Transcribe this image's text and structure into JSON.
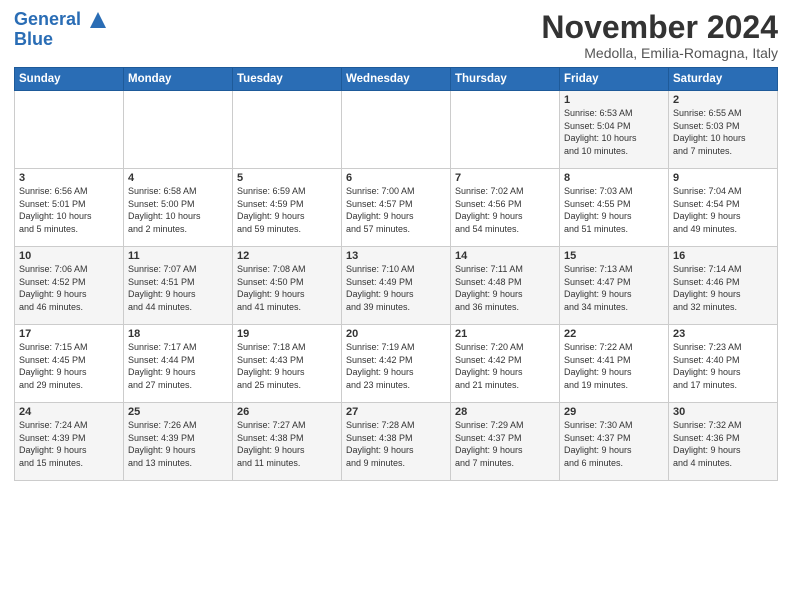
{
  "header": {
    "logo_line1": "General",
    "logo_line2": "Blue",
    "month_title": "November 2024",
    "subtitle": "Medolla, Emilia-Romagna, Italy"
  },
  "weekdays": [
    "Sunday",
    "Monday",
    "Tuesday",
    "Wednesday",
    "Thursday",
    "Friday",
    "Saturday"
  ],
  "weeks": [
    [
      {
        "day": "",
        "info": ""
      },
      {
        "day": "",
        "info": ""
      },
      {
        "day": "",
        "info": ""
      },
      {
        "day": "",
        "info": ""
      },
      {
        "day": "",
        "info": ""
      },
      {
        "day": "1",
        "info": "Sunrise: 6:53 AM\nSunset: 5:04 PM\nDaylight: 10 hours\nand 10 minutes."
      },
      {
        "day": "2",
        "info": "Sunrise: 6:55 AM\nSunset: 5:03 PM\nDaylight: 10 hours\nand 7 minutes."
      }
    ],
    [
      {
        "day": "3",
        "info": "Sunrise: 6:56 AM\nSunset: 5:01 PM\nDaylight: 10 hours\nand 5 minutes."
      },
      {
        "day": "4",
        "info": "Sunrise: 6:58 AM\nSunset: 5:00 PM\nDaylight: 10 hours\nand 2 minutes."
      },
      {
        "day": "5",
        "info": "Sunrise: 6:59 AM\nSunset: 4:59 PM\nDaylight: 9 hours\nand 59 minutes."
      },
      {
        "day": "6",
        "info": "Sunrise: 7:00 AM\nSunset: 4:57 PM\nDaylight: 9 hours\nand 57 minutes."
      },
      {
        "day": "7",
        "info": "Sunrise: 7:02 AM\nSunset: 4:56 PM\nDaylight: 9 hours\nand 54 minutes."
      },
      {
        "day": "8",
        "info": "Sunrise: 7:03 AM\nSunset: 4:55 PM\nDaylight: 9 hours\nand 51 minutes."
      },
      {
        "day": "9",
        "info": "Sunrise: 7:04 AM\nSunset: 4:54 PM\nDaylight: 9 hours\nand 49 minutes."
      }
    ],
    [
      {
        "day": "10",
        "info": "Sunrise: 7:06 AM\nSunset: 4:52 PM\nDaylight: 9 hours\nand 46 minutes."
      },
      {
        "day": "11",
        "info": "Sunrise: 7:07 AM\nSunset: 4:51 PM\nDaylight: 9 hours\nand 44 minutes."
      },
      {
        "day": "12",
        "info": "Sunrise: 7:08 AM\nSunset: 4:50 PM\nDaylight: 9 hours\nand 41 minutes."
      },
      {
        "day": "13",
        "info": "Sunrise: 7:10 AM\nSunset: 4:49 PM\nDaylight: 9 hours\nand 39 minutes."
      },
      {
        "day": "14",
        "info": "Sunrise: 7:11 AM\nSunset: 4:48 PM\nDaylight: 9 hours\nand 36 minutes."
      },
      {
        "day": "15",
        "info": "Sunrise: 7:13 AM\nSunset: 4:47 PM\nDaylight: 9 hours\nand 34 minutes."
      },
      {
        "day": "16",
        "info": "Sunrise: 7:14 AM\nSunset: 4:46 PM\nDaylight: 9 hours\nand 32 minutes."
      }
    ],
    [
      {
        "day": "17",
        "info": "Sunrise: 7:15 AM\nSunset: 4:45 PM\nDaylight: 9 hours\nand 29 minutes."
      },
      {
        "day": "18",
        "info": "Sunrise: 7:17 AM\nSunset: 4:44 PM\nDaylight: 9 hours\nand 27 minutes."
      },
      {
        "day": "19",
        "info": "Sunrise: 7:18 AM\nSunset: 4:43 PM\nDaylight: 9 hours\nand 25 minutes."
      },
      {
        "day": "20",
        "info": "Sunrise: 7:19 AM\nSunset: 4:42 PM\nDaylight: 9 hours\nand 23 minutes."
      },
      {
        "day": "21",
        "info": "Sunrise: 7:20 AM\nSunset: 4:42 PM\nDaylight: 9 hours\nand 21 minutes."
      },
      {
        "day": "22",
        "info": "Sunrise: 7:22 AM\nSunset: 4:41 PM\nDaylight: 9 hours\nand 19 minutes."
      },
      {
        "day": "23",
        "info": "Sunrise: 7:23 AM\nSunset: 4:40 PM\nDaylight: 9 hours\nand 17 minutes."
      }
    ],
    [
      {
        "day": "24",
        "info": "Sunrise: 7:24 AM\nSunset: 4:39 PM\nDaylight: 9 hours\nand 15 minutes."
      },
      {
        "day": "25",
        "info": "Sunrise: 7:26 AM\nSunset: 4:39 PM\nDaylight: 9 hours\nand 13 minutes."
      },
      {
        "day": "26",
        "info": "Sunrise: 7:27 AM\nSunset: 4:38 PM\nDaylight: 9 hours\nand 11 minutes."
      },
      {
        "day": "27",
        "info": "Sunrise: 7:28 AM\nSunset: 4:38 PM\nDaylight: 9 hours\nand 9 minutes."
      },
      {
        "day": "28",
        "info": "Sunrise: 7:29 AM\nSunset: 4:37 PM\nDaylight: 9 hours\nand 7 minutes."
      },
      {
        "day": "29",
        "info": "Sunrise: 7:30 AM\nSunset: 4:37 PM\nDaylight: 9 hours\nand 6 minutes."
      },
      {
        "day": "30",
        "info": "Sunrise: 7:32 AM\nSunset: 4:36 PM\nDaylight: 9 hours\nand 4 minutes."
      }
    ]
  ]
}
